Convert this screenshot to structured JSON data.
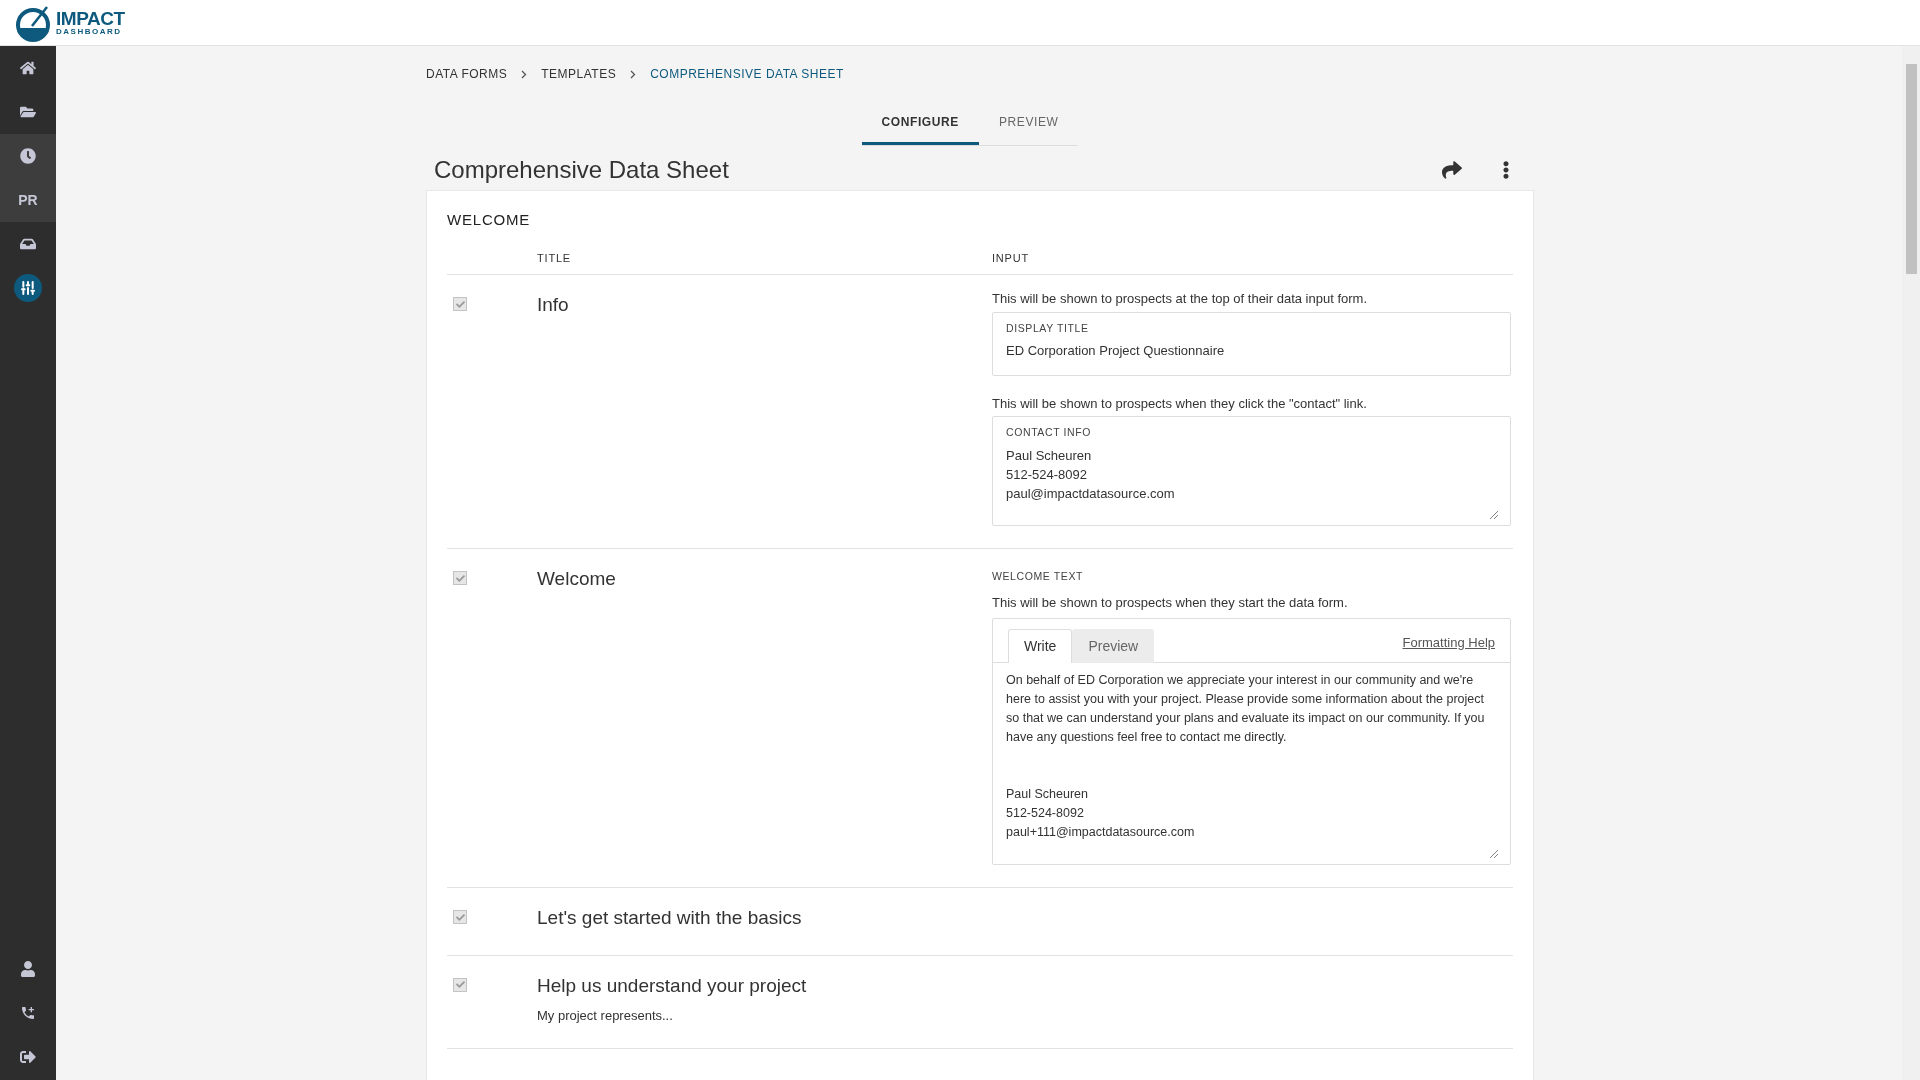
{
  "logo": {
    "name": "IMPACT",
    "tagline": "DASHBOARD"
  },
  "sidebar": {
    "items": [
      {
        "kind": "home",
        "selected": false,
        "highlighted": false
      },
      {
        "kind": "folder",
        "selected": false,
        "highlighted": false
      },
      {
        "kind": "clock",
        "selected": false,
        "highlighted": true
      },
      {
        "kind": "text",
        "label": "PR",
        "selected": false,
        "highlighted": true
      },
      {
        "kind": "inbox",
        "selected": false,
        "highlighted": false
      },
      {
        "kind": "sliders",
        "selected": true,
        "highlighted": false
      }
    ],
    "bottom_items": [
      {
        "kind": "user"
      },
      {
        "kind": "phone"
      },
      {
        "kind": "signout"
      }
    ]
  },
  "breadcrumb": [
    "DATA FORMS",
    "TEMPLATES",
    "COMPREHENSIVE DATA SHEET"
  ],
  "tabs": [
    {
      "label": "CONFIGURE",
      "selected": true
    },
    {
      "label": "PREVIEW",
      "selected": false
    }
  ],
  "page_title": "Comprehensive Data Sheet",
  "section": {
    "title": "WELCOME",
    "columns": [
      "TITLE",
      "INPUT"
    ],
    "rows": [
      {
        "kind": "fields",
        "checked": true,
        "title": "Info",
        "fields": [
          {
            "hint": "This will be shown to prospects at the top of their data input form.",
            "label": "DISPLAY TITLE",
            "value": "ED Corporation Project Questionnaire",
            "multiline": false
          },
          {
            "hint": "This will be shown to prospects when they click the \"contact\" link.",
            "label": "CONTACT INFO",
            "value": "Paul Scheuren\n512-524-8092\npaul@impactdatasource.com",
            "multiline": true
          }
        ]
      },
      {
        "kind": "markdown",
        "checked": true,
        "title": "Welcome",
        "label": "WELCOME TEXT",
        "hint": "This will be shown to prospects when they start the data form.",
        "editor_tabs": [
          {
            "label": "Write",
            "selected": true
          },
          {
            "label": "Preview",
            "selected": false
          }
        ],
        "help_link": "Formatting Help",
        "value": "On behalf of ED Corporation we appreciate your interest in our community and we're here to assist you with your project. Please provide some information about the project so that we can understand your plans and evaluate its impact on our community. If you have any questions feel free to contact me directly.\n\n\nPaul Scheuren\n512-524-8092\npaul+111@impactdatasource.com"
      },
      {
        "kind": "plain",
        "checked": true,
        "title": "Let's get started with the basics"
      },
      {
        "kind": "plain",
        "checked": true,
        "title": "Help us understand your project",
        "subtitle": "My project represents..."
      }
    ]
  }
}
